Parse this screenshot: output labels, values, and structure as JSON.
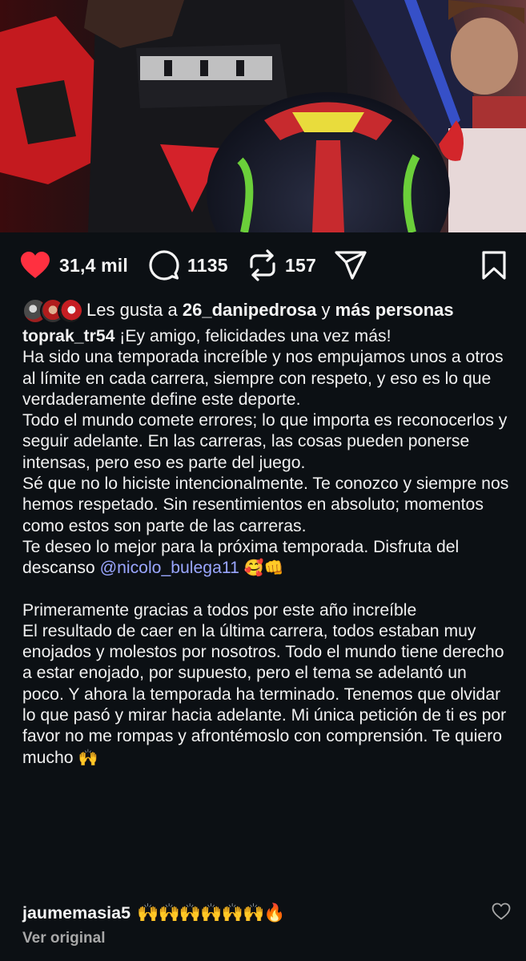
{
  "post": {
    "likes_count": "31,4 mil",
    "comments_count": "1135",
    "reposts_count": "157",
    "liked_by_prefix": "Les gusta a",
    "liked_by_user": "26_danipedrosa",
    "liked_by_joiner": "y",
    "liked_by_suffix": "más personas"
  },
  "icons": {
    "like": "heart-icon",
    "comment": "comment-bubble-icon",
    "repost": "repost-icon",
    "share": "paper-plane-icon",
    "save": "bookmark-icon"
  },
  "colors": {
    "background": "#0c1014",
    "heart": "#ff3040",
    "mention": "#9aa6ff",
    "secondary_text": "#a8a8a8"
  },
  "caption": {
    "author": "toprak_tr54",
    "line1": "¡Ey amigo, felicidades una vez más!",
    "p1": "Ha sido una temporada increíble y nos empujamos unos a otros al límite en cada carrera, siempre con respeto, y eso es lo que verdaderamente define este deporte.",
    "p2": "Todo el mundo comete errores; lo que importa es reconocerlos y seguir adelante. En las carreras, las cosas pueden ponerse intensas, pero eso es parte del juego.",
    "p3": "Sé que no lo hiciste intencionalmente. Te conozco y siempre nos hemos respetado. Sin resentimientos en absoluto; momentos como estos son parte de las carreras.",
    "p4_text": "Te deseo lo mejor para la próxima temporada. Disfruta del descanso",
    "p4_mention": "@nicolo_bulega11",
    "p4_emoji": "🥰👊",
    "p5": "Primeramente gracias a todos por este año increíble",
    "p6_text": "El resultado de caer en la última carrera, todos estaban muy enojados y molestos por nosotros. Todo el mundo tiene derecho a estar enojado, por supuesto, pero el tema se adelantó un poco. Y ahora la temporada ha terminado. Tenemos que olvidar lo que pasó y mirar hacia adelante. Mi única petición de ti es por favor no me rompas y afrontémoslo con comprensión. Te quiero mucho",
    "p6_emoji": "🙌"
  },
  "comment": {
    "author": "jaumemasia5",
    "text": "🙌🙌🙌🙌🙌🙌🔥"
  },
  "translation": {
    "link_label": "Ver original"
  }
}
